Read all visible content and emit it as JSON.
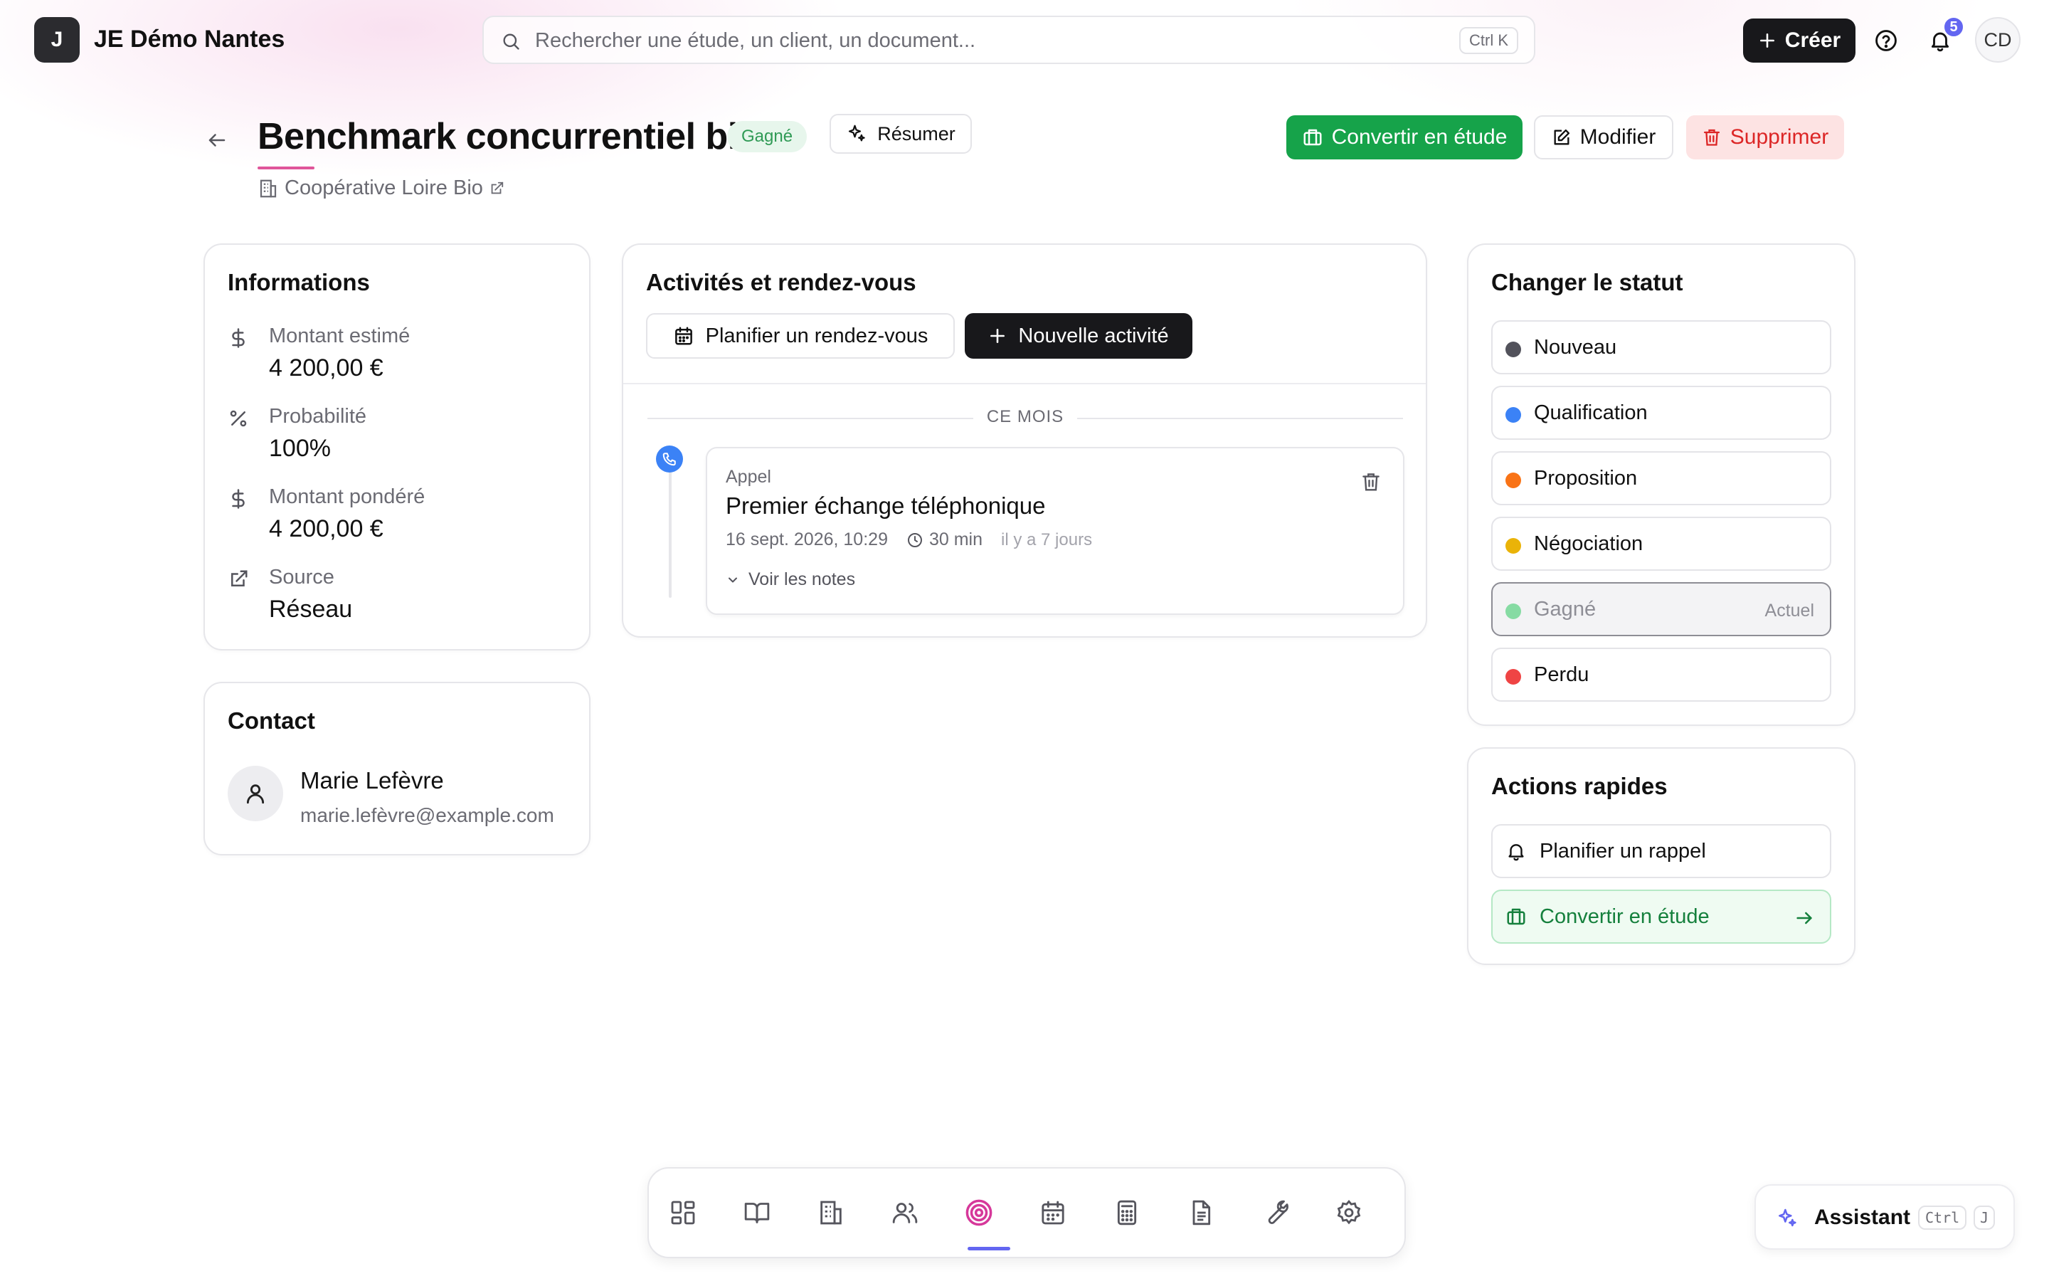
{
  "app": {
    "logo_letter": "J",
    "org_name": "JE Démo Nantes"
  },
  "search": {
    "placeholder": "Rechercher une étude, un client, un document...",
    "shortcut": "Ctrl K"
  },
  "topbar": {
    "create_label": "Créer",
    "notifications_count": "5",
    "user_initials": "CD"
  },
  "page": {
    "title": "Benchmark concurrentiel bio",
    "status_badge": "Gagné",
    "summarize_label": "Résumer",
    "client_name": "Coopérative Loire Bio",
    "actions": {
      "convert": "Convertir en étude",
      "edit": "Modifier",
      "delete": "Supprimer"
    }
  },
  "info": {
    "title": "Informations",
    "items": [
      {
        "label": "Montant estimé",
        "value": "4 200,00 €",
        "icon": "dollar-icon"
      },
      {
        "label": "Probabilité",
        "value": "100%",
        "icon": "percent-icon"
      },
      {
        "label": "Montant pondéré",
        "value": "4 200,00 €",
        "icon": "dollar-icon"
      },
      {
        "label": "Source",
        "value": "Réseau",
        "icon": "external-link-icon"
      }
    ]
  },
  "contact": {
    "title": "Contact",
    "name": "Marie Lefèvre",
    "email": "marie.lefèvre@example.com"
  },
  "activities": {
    "title": "Activités et rendez-vous",
    "plan_label": "Planifier un rendez-vous",
    "new_label": "Nouvelle activité",
    "month_label": "CE MOIS",
    "items": [
      {
        "type": "Appel",
        "title": "Premier échange téléphonique",
        "datetime": "16 sept. 2026, 10:29",
        "duration": "30 min",
        "ago": "il y a 7 jours",
        "notes_label": "Voir les notes"
      }
    ]
  },
  "status": {
    "title": "Changer le statut",
    "current_tag": "Actuel",
    "options": [
      {
        "label": "Nouveau",
        "color": "#52525b"
      },
      {
        "label": "Qualification",
        "color": "#3b82f6"
      },
      {
        "label": "Proposition",
        "color": "#f97316"
      },
      {
        "label": "Négociation",
        "color": "#eab308"
      },
      {
        "label": "Gagné",
        "color": "#86dba3",
        "current": true
      },
      {
        "label": "Perdu",
        "color": "#ef4444"
      }
    ]
  },
  "quick_actions": {
    "title": "Actions rapides",
    "reminder_label": "Planifier un rappel",
    "convert_label": "Convertir en étude"
  },
  "dock": {
    "items": [
      "dashboard-icon",
      "book-icon",
      "building-icon",
      "users-icon",
      "target-icon",
      "calendar-icon",
      "calculator-icon",
      "document-icon",
      "wrench-icon",
      "settings-icon"
    ],
    "active": "target-icon"
  },
  "assistant": {
    "label": "Assistant",
    "shortcut_mod": "Ctrl",
    "shortcut_key": "J"
  },
  "colors": {
    "accent_pink": "#e0559a",
    "success": "#16a34a",
    "danger": "#dc2626",
    "indigo": "#6366f1"
  }
}
